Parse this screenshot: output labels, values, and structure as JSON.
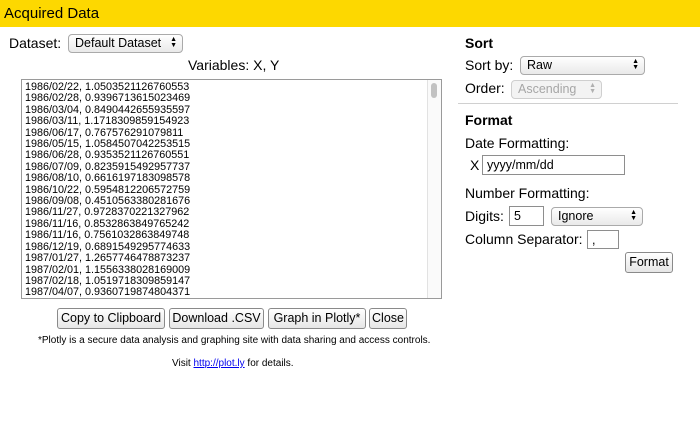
{
  "window": {
    "title": "Acquired Data"
  },
  "dataset": {
    "label": "Dataset:",
    "selected": "Default Dataset"
  },
  "variables_label": "Variables: X, Y",
  "data_rows": [
    "1986/02/22, 1.0503521126760553",
    "1986/02/28, 0.9396713615023469",
    "1986/03/04, 0.8490442655935597",
    "1986/03/11, 1.1718309859154923",
    "1986/06/17, 0.767576291079811",
    "1986/05/15, 1.0584507042253515",
    "1986/06/28, 0.9353521126760551",
    "1986/07/09, 0.8235915492957737",
    "1986/08/10, 0.6616197183098578",
    "1986/10/22, 0.5954812206572759",
    "1986/09/08, 0.4510563380281676",
    "1986/11/27, 0.9728370221327962",
    "1986/11/16, 0.8532863849765242",
    "1986/11/16, 0.7561032863849748",
    "1986/12/19, 0.6891549295774633",
    "1987/01/27, 1.2657746478873237",
    "1987/02/01, 1.1556338028169009",
    "1987/02/18, 1.0519718309859147",
    "1987/04/07, 0.9360719874804371"
  ],
  "buttons": {
    "copy": "Copy to Clipboard",
    "download": "Download .CSV",
    "plotly": "Graph in Plotly*",
    "close": "Close"
  },
  "notes": {
    "plotly_note": "*Plotly is a secure data analysis and graphing site with data sharing and access controls.",
    "visit_prefix": "Visit ",
    "visit_link": "http://plot.ly",
    "visit_suffix": " for details."
  },
  "sort": {
    "heading": "Sort",
    "sort_by_label": "Sort by:",
    "sort_by_value": "Raw",
    "order_label": "Order:",
    "order_value": "Ascending"
  },
  "format": {
    "heading": "Format",
    "date_label": "Date Formatting:",
    "date_var": "X",
    "date_value": "yyyy/mm/dd",
    "number_label": "Number Formatting:",
    "digits_label": "Digits:",
    "digits_value": "5",
    "digits_mode": "Ignore",
    "separator_label": "Column Separator:",
    "separator_value": ",",
    "format_button": "Format"
  }
}
